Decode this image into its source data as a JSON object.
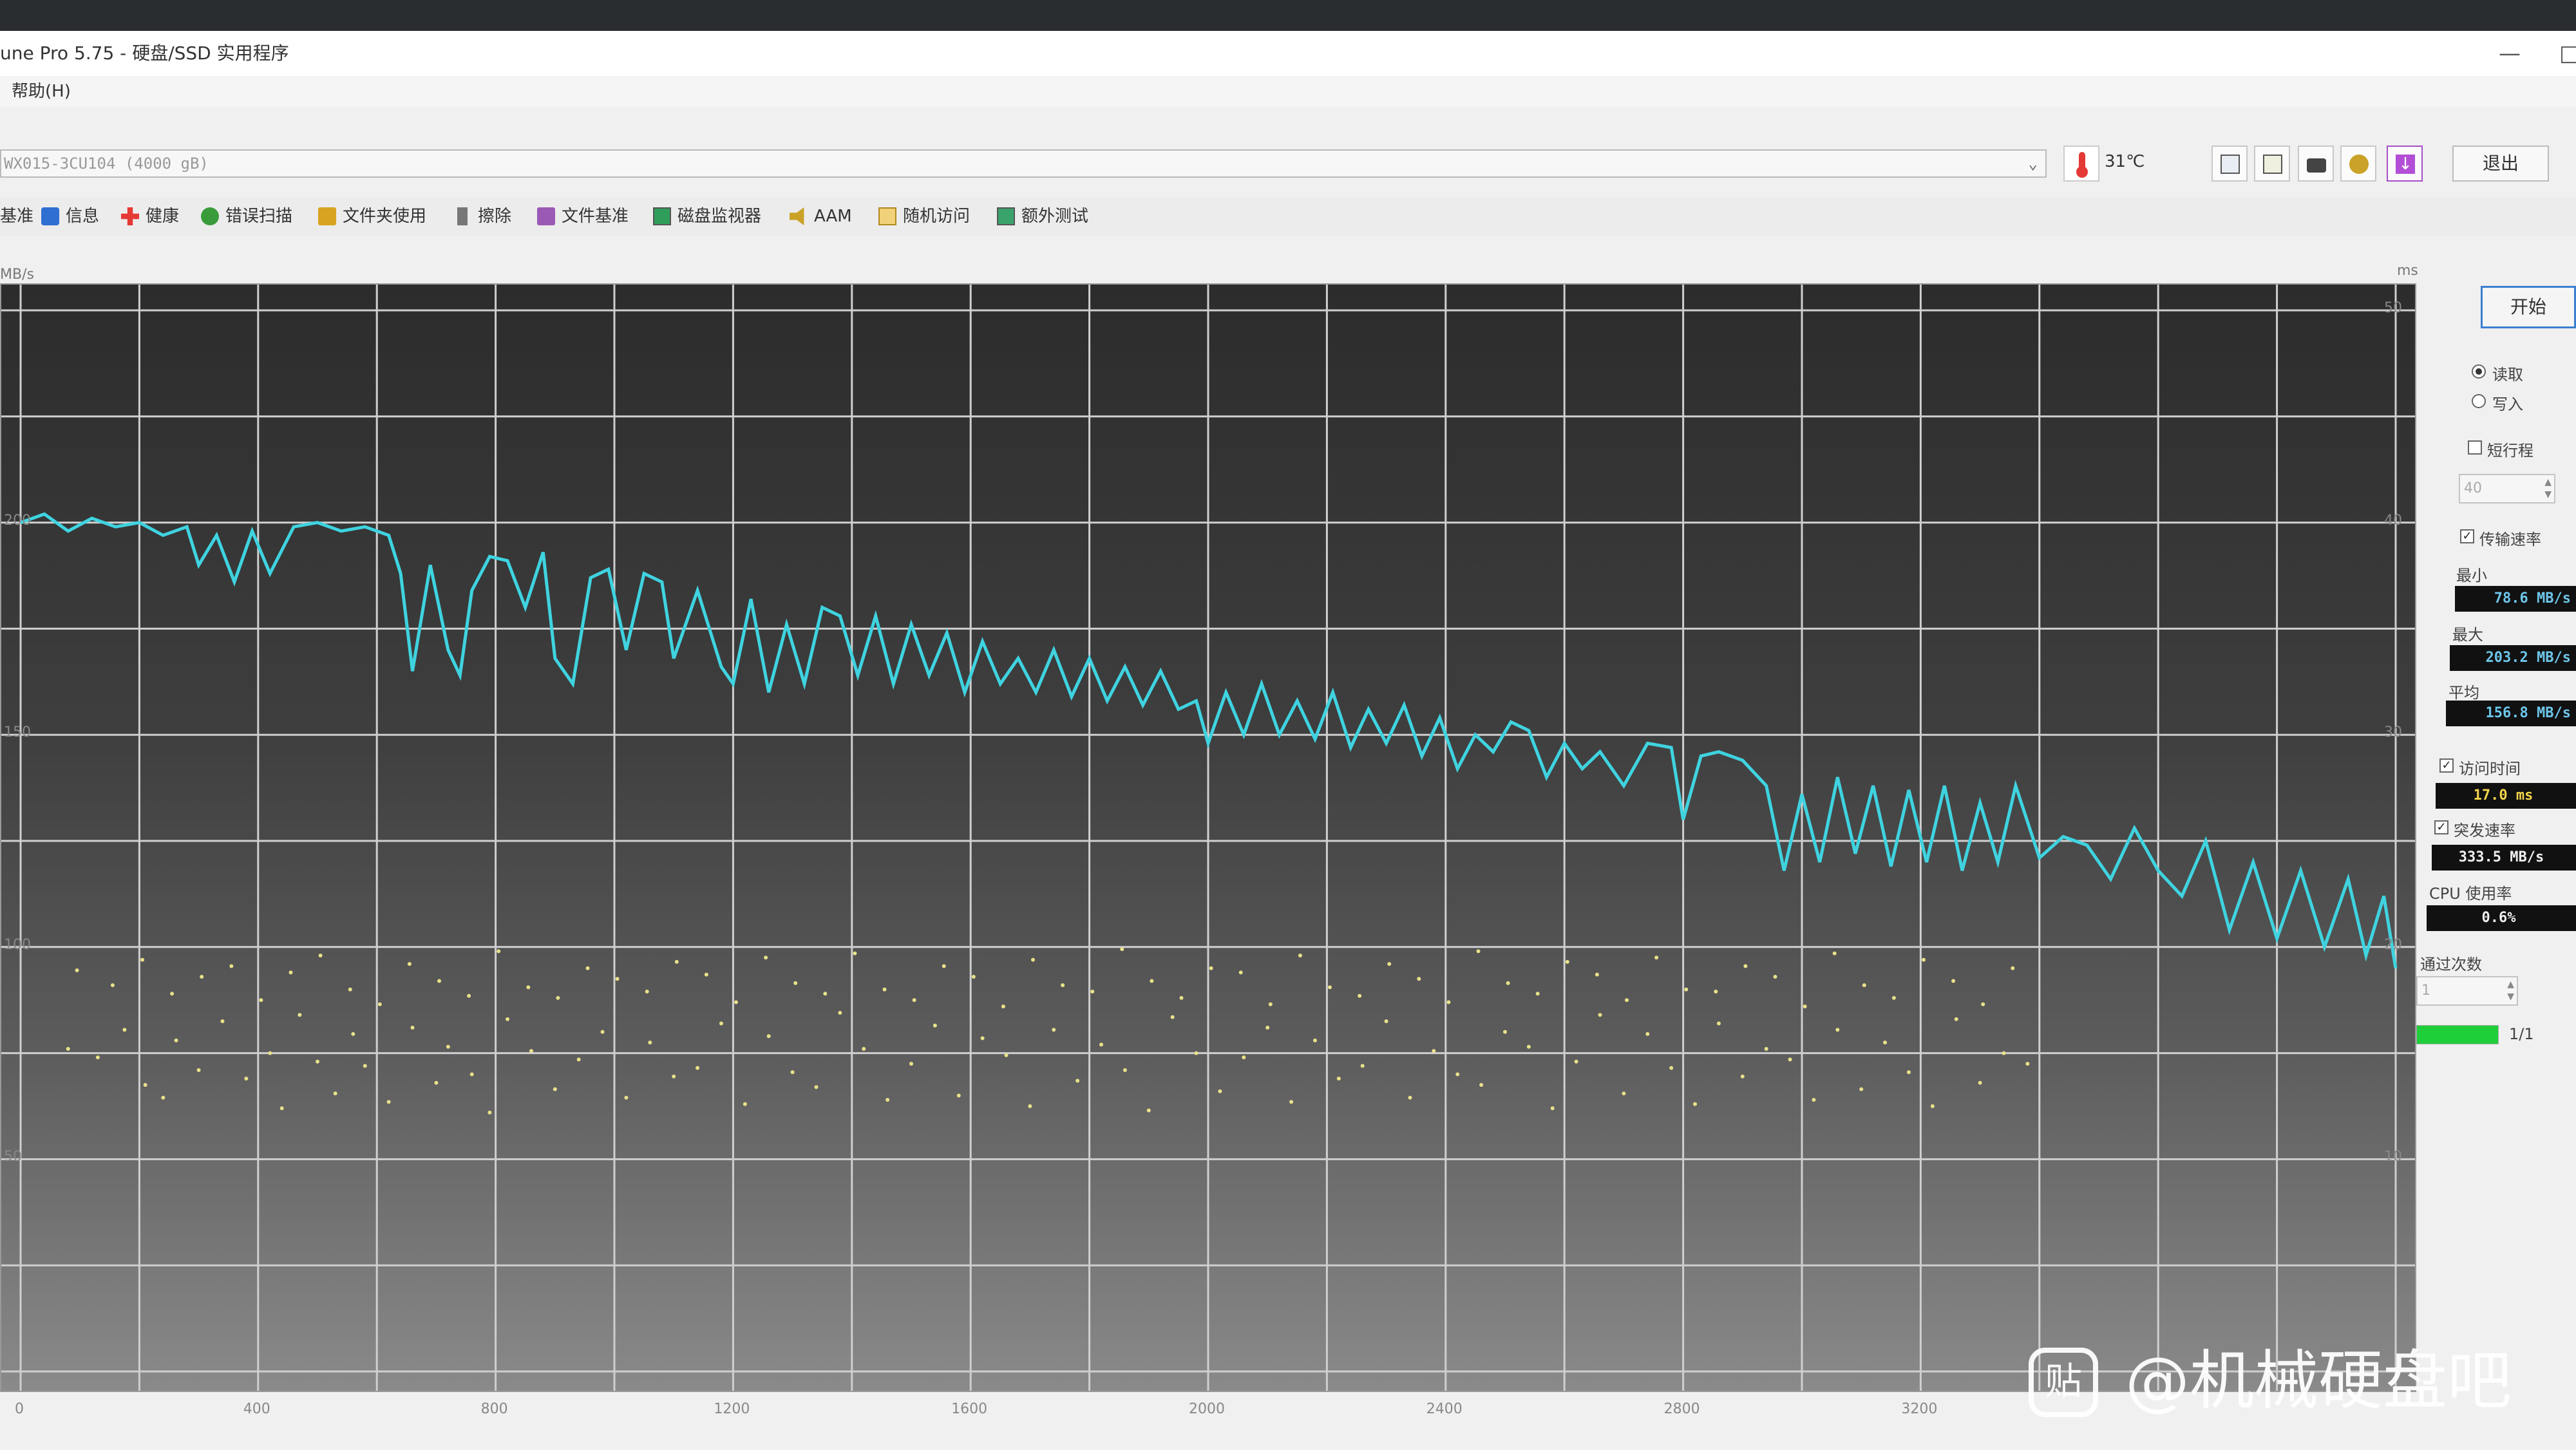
{
  "window": {
    "title": "une Pro 5.75 - 硬盘/SSD 实用程序",
    "minimize_glyph": "—",
    "maximize_glyph": "□"
  },
  "menubar": {
    "help": "帮助(H)"
  },
  "drivebar": {
    "drive": "WX015-3CU104 (4000 gB)",
    "temperature": "31",
    "exit_label": "退出",
    "tool_icons": [
      "copy-info-icon",
      "copy-text-icon",
      "screenshot-icon",
      "settings-icon",
      "download-icon"
    ]
  },
  "tabs": [
    {
      "label": "基准",
      "icon": "benchmark-icon"
    },
    {
      "label": "信息",
      "icon": "info-icon"
    },
    {
      "label": "健康",
      "icon": "health-icon"
    },
    {
      "label": "错误扫描",
      "icon": "error-scan-icon"
    },
    {
      "label": "文件夹使用",
      "icon": "folder-icon"
    },
    {
      "label": "擦除",
      "icon": "erase-icon"
    },
    {
      "label": "文件基准",
      "icon": "file-benchmark-icon"
    },
    {
      "label": "磁盘监视器",
      "icon": "disk-monitor-icon"
    },
    {
      "label": "AAM",
      "icon": "speaker-icon"
    },
    {
      "label": "随机访问",
      "icon": "random-access-icon"
    },
    {
      "label": "额外测试",
      "icon": "extra-tests-icon"
    }
  ],
  "panel": {
    "start_label": "开始",
    "read_label": "读取",
    "write_label": "写入",
    "read_selected": true,
    "short_stroke_label": "短行程",
    "short_stroke_checked": false,
    "short_stroke_value": "40",
    "transfer_rate_label": "传输速率",
    "transfer_rate_checked": true,
    "min_label": "最小",
    "min_value": "78.6 MB/s",
    "max_label": "最大",
    "max_value": "203.2 MB/s",
    "avg_label": "平均",
    "avg_value": "156.8 MB/s",
    "access_time_label": "访问时间",
    "access_time_checked": true,
    "access_time_value": "17.0 ms",
    "burst_rate_label": "突发速率",
    "burst_rate_checked": true,
    "burst_rate_value": "333.5 MB/s",
    "cpu_label": "CPU 使用率",
    "cpu_value": "0.6%",
    "passes_label": "通过次数",
    "passes_value": "1",
    "progress_text": "1/1",
    "progress_fraction": 1.0,
    "progress_color": "#1fcf3a"
  },
  "chart_data": {
    "type": "line",
    "left_unit": "MB/s",
    "right_unit": "ms",
    "x_ticks": [
      "0",
      "400",
      "800",
      "1200",
      "1600",
      "2000",
      "2400",
      "2800",
      "3200"
    ],
    "left_ticks": [
      "50",
      "100",
      "150",
      "200"
    ],
    "right_ticks": [
      "10",
      "20",
      "30",
      "40",
      "50"
    ],
    "xlim": [
      0,
      4000
    ],
    "ylim_left": [
      0,
      250
    ],
    "ylim_right": [
      0,
      50
    ],
    "grid": true,
    "line_color": "#3fd3e0",
    "dot_color": "#e8e18a",
    "transfer_rate": {
      "name": "传输速率",
      "x": [
        0,
        40,
        80,
        120,
        160,
        200,
        240,
        280,
        300,
        330,
        360,
        390,
        420,
        460,
        500,
        540,
        580,
        620,
        640,
        660,
        690,
        720,
        740,
        760,
        790,
        820,
        850,
        880,
        900,
        930,
        960,
        990,
        1020,
        1050,
        1080,
        1100,
        1140,
        1180,
        1200,
        1230,
        1260,
        1290,
        1320,
        1350,
        1380,
        1410,
        1440,
        1470,
        1500,
        1530,
        1560,
        1590,
        1620,
        1650,
        1680,
        1710,
        1740,
        1770,
        1800,
        1830,
        1860,
        1890,
        1920,
        1950,
        1980,
        2000,
        2030,
        2060,
        2090,
        2120,
        2150,
        2180,
        2210,
        2240,
        2270,
        2300,
        2330,
        2360,
        2390,
        2420,
        2450,
        2480,
        2510,
        2540,
        2570,
        2600,
        2630,
        2660,
        2700,
        2740,
        2780,
        2800,
        2830,
        2860,
        2900,
        2940,
        2970,
        3000,
        3030,
        3060,
        3090,
        3120,
        3150,
        3180,
        3210,
        3240,
        3270,
        3300,
        3330,
        3360,
        3400,
        3440,
        3480,
        3520,
        3560,
        3600,
        3640,
        3680,
        3720,
        3760,
        3800,
        3840,
        3880,
        3920,
        3950,
        3980,
        4000
      ],
      "y": [
        200,
        202,
        198,
        201,
        199,
        200,
        197,
        199,
        190,
        197,
        186,
        198,
        188,
        199,
        200,
        198,
        199,
        197,
        188,
        165,
        190,
        170,
        164,
        184,
        192,
        191,
        180,
        193,
        168,
        162,
        187,
        189,
        170,
        188,
        186,
        168,
        184,
        166,
        162,
        182,
        160,
        176,
        162,
        180,
        178,
        164,
        178,
        162,
        176,
        164,
        174,
        160,
        172,
        162,
        168,
        160,
        170,
        159,
        168,
        158,
        166,
        157,
        165,
        156,
        158,
        148,
        160,
        150,
        162,
        150,
        158,
        149,
        160,
        147,
        156,
        148,
        157,
        145,
        154,
        142,
        150,
        146,
        153,
        151,
        140,
        148,
        142,
        146,
        138,
        148,
        147,
        130,
        145,
        146,
        144,
        138,
        118,
        136,
        120,
        140,
        122,
        138,
        119,
        137,
        120,
        138,
        118,
        134,
        120,
        138,
        121,
        126,
        124,
        116,
        128,
        118,
        112,
        125,
        104,
        120,
        102,
        118,
        100,
        116,
        98,
        112,
        95,
        90
      ]
    },
    "access_time": {
      "name": "访问时间",
      "x": [
        80,
        130,
        175,
        210,
        240,
        262,
        300,
        340,
        380,
        420,
        440,
        470,
        500,
        530,
        560,
        580,
        620,
        660,
        700,
        720,
        760,
        790,
        820,
        860,
        900,
        940,
        980,
        1020,
        1060,
        1100,
        1140,
        1180,
        1220,
        1260,
        1300,
        1340,
        1380,
        1420,
        1460,
        1500,
        1540,
        1580,
        1620,
        1660,
        1700,
        1740,
        1780,
        1820,
        1860,
        1900,
        1940,
        1980,
        2020,
        2060,
        2100,
        2140,
        2180,
        2220,
        2260,
        2300,
        2340,
        2380,
        2420,
        2460,
        2500,
        2540,
        2580,
        2620,
        2660,
        2700,
        2740,
        2780,
        2820,
        2860,
        2900,
        2940,
        2980,
        3020,
        3060,
        3100,
        3140,
        3180,
        3220,
        3260,
        3300,
        3340,
        3380,
        95,
        155,
        205,
        255,
        305,
        355,
        405,
        455,
        505,
        555,
        605,
        655,
        705,
        755,
        805,
        855,
        905,
        955,
        1005,
        1055,
        1105,
        1155,
        1205,
        1255,
        1305,
        1355,
        1405,
        1455,
        1505,
        1555,
        1605,
        1655,
        1705,
        1755,
        1805,
        1855,
        1905,
        1955,
        2005,
        2055,
        2105,
        2155,
        2205,
        2255,
        2305,
        2355,
        2405,
        2455,
        2505,
        2555,
        2605,
        2655,
        2705,
        2755,
        2805,
        2855,
        2905,
        2955,
        3005,
        3055,
        3105,
        3155,
        3205,
        3255,
        3305,
        3355
      ],
      "y": [
        15.2,
        14.8,
        16.1,
        13.5,
        12.9,
        15.6,
        14.2,
        16.5,
        13.8,
        15.0,
        12.4,
        16.8,
        14.6,
        13.1,
        15.9,
        14.4,
        12.7,
        16.2,
        13.6,
        15.3,
        14.0,
        12.2,
        16.6,
        15.1,
        13.3,
        14.7,
        16.0,
        12.9,
        15.5,
        13.9,
        14.3,
        16.4,
        12.6,
        15.8,
        14.1,
        13.4,
        16.9,
        15.2,
        12.8,
        14.5,
        16.3,
        13.0,
        15.7,
        14.9,
        12.5,
        16.1,
        13.7,
        15.4,
        14.2,
        12.3,
        16.7,
        15.0,
        13.2,
        14.8,
        16.2,
        12.7,
        15.6,
        13.8,
        14.4,
        16.5,
        12.9,
        15.1,
        14.0,
        13.5,
        16.0,
        15.3,
        12.4,
        14.6,
        16.8,
        13.1,
        15.9,
        14.3,
        12.6,
        16.4,
        13.9,
        15.2,
        14.7,
        12.8,
        16.1,
        13.3,
        15.5,
        14.1,
        12.5,
        16.6,
        13.6,
        15.0,
        14.5,
        18.9,
        18.2,
        19.4,
        17.8,
        18.6,
        19.1,
        17.5,
        18.8,
        19.6,
        18.0,
        17.3,
        19.2,
        18.4,
        17.7,
        19.8,
        18.1,
        17.6,
        19.0,
        18.5,
        17.9,
        19.3,
        18.7,
        17.4,
        19.5,
        18.3,
        17.8,
        19.7,
        18.0,
        17.5,
        19.1,
        18.6,
        17.2,
        19.4,
        18.2,
        17.9,
        19.9,
        18.4,
        17.6,
        19.0,
        18.8,
        17.3,
        19.6,
        18.1,
        17.7,
        19.2,
        18.5,
        17.4,
        19.8,
        18.3,
        17.8,
        19.3,
        18.7,
        17.5,
        19.5,
        18.0,
        17.9,
        19.1,
        18.6,
        17.2,
        19.7,
        18.2,
        17.6,
        19.4,
        18.4,
        17.3,
        19.0,
        18.9,
        17.7
      ]
    }
  },
  "watermark": {
    "logo_glyph": "贴",
    "text": "@机械硬盘吧"
  }
}
